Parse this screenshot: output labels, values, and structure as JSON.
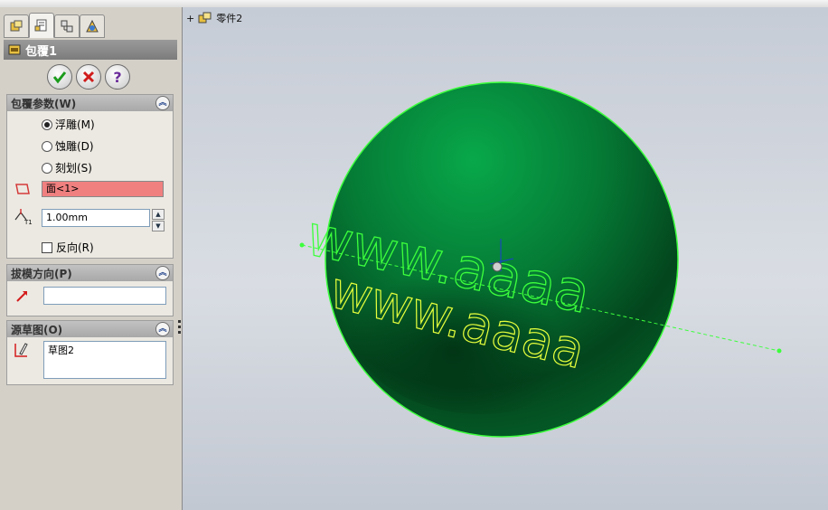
{
  "feature": {
    "title": "包覆1"
  },
  "buttons": {
    "ok_icon": "checkmark-icon",
    "cancel_icon": "x-icon",
    "help_label": "?"
  },
  "wrap_params": {
    "header": "包覆参数(W)",
    "options": [
      {
        "label": "浮雕(M)",
        "selected": true
      },
      {
        "label": "蚀雕(D)",
        "selected": false
      },
      {
        "label": "刻划(S)",
        "selected": false
      }
    ],
    "face_value": "面<1>",
    "thickness": "1.00mm",
    "reverse_label": "反向(R)",
    "reverse_checked": false
  },
  "draft_direction": {
    "header": "拔模方向(P)",
    "value": ""
  },
  "source_sketch": {
    "header": "源草图(O)",
    "value": "草图2"
  },
  "tree": {
    "expand": "+",
    "part_name": "零件2"
  },
  "sphere": {
    "color": "#0b7a35",
    "edge_color": "#3cff3c",
    "text_color": "#e6ff3c",
    "wrapped_text_top": "www.aaaa",
    "wrapped_text_bottom": "www.aaaa"
  }
}
